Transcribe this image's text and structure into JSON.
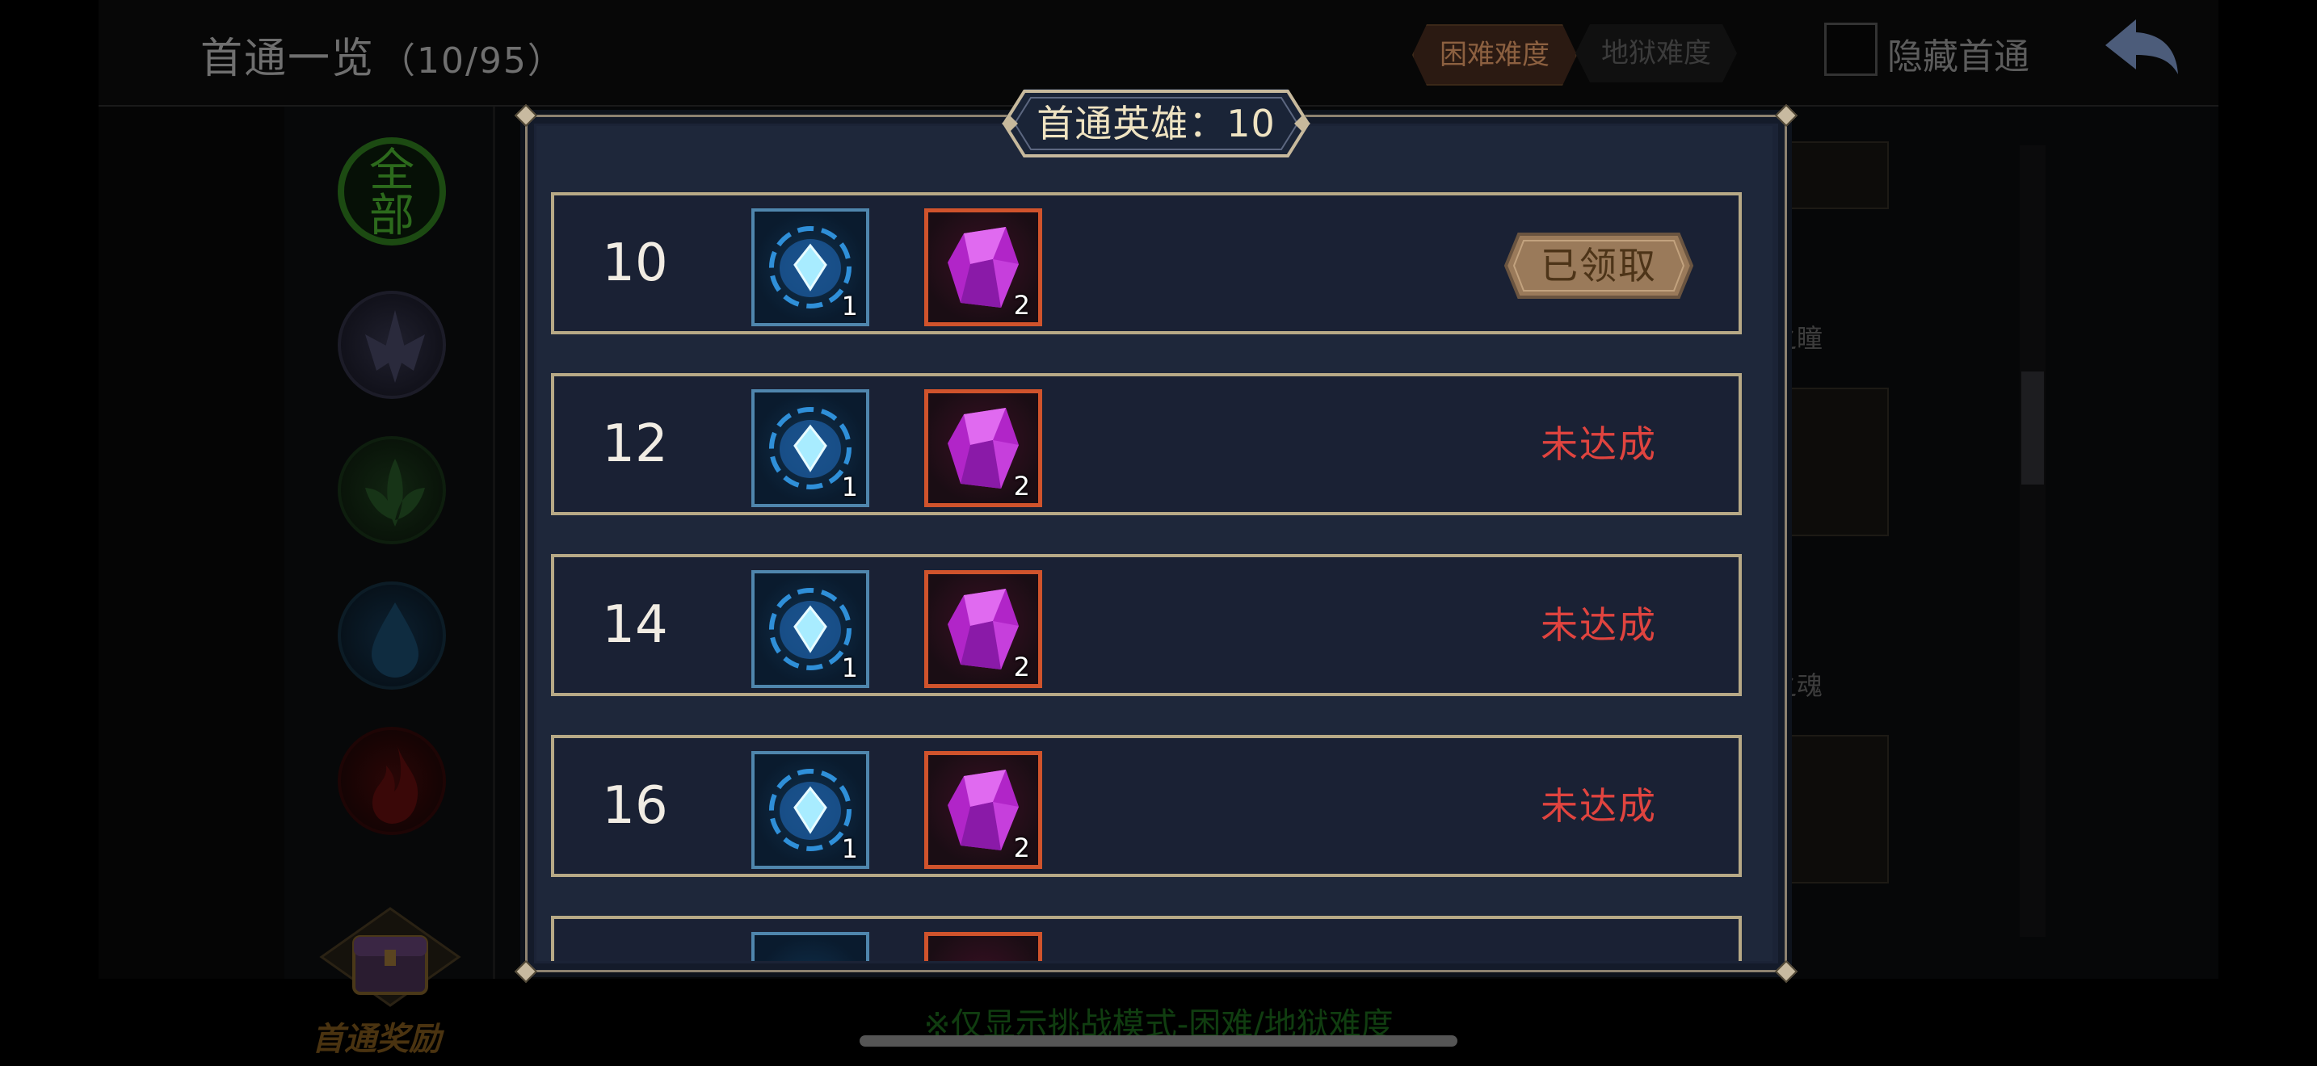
{
  "header": {
    "title": "首通一览",
    "count": "（10/95）",
    "tabs": [
      {
        "label": "困难难度",
        "active": true
      },
      {
        "label": "地狱难度",
        "active": false
      }
    ],
    "hide_checkbox_label": "隐藏首通",
    "hide_checked": false,
    "back_icon": "back-arrow-icon"
  },
  "sidebar": {
    "categories": [
      {
        "name": "all",
        "label": "全部"
      },
      {
        "name": "dark"
      },
      {
        "name": "nature"
      },
      {
        "name": "water"
      },
      {
        "name": "fire"
      }
    ],
    "reward_label": "首通奖励"
  },
  "background_cards": [
    "之瞳",
    "之魂"
  ],
  "bottom_note": "※仅显示挑战模式-困难/地狱难度",
  "modal": {
    "title": "首通英雄：10",
    "rows": [
      {
        "level": "10",
        "items": [
          {
            "icon": "blue-crystal-icon",
            "qty": "1"
          },
          {
            "icon": "purple-gem-icon",
            "qty": "2"
          }
        ],
        "status": "已领取",
        "state": "claimed"
      },
      {
        "level": "12",
        "items": [
          {
            "icon": "blue-crystal-icon",
            "qty": "1"
          },
          {
            "icon": "purple-gem-icon",
            "qty": "2"
          }
        ],
        "status": "未达成",
        "state": "pending"
      },
      {
        "level": "14",
        "items": [
          {
            "icon": "blue-crystal-icon",
            "qty": "1"
          },
          {
            "icon": "purple-gem-icon",
            "qty": "2"
          }
        ],
        "status": "未达成",
        "state": "pending"
      },
      {
        "level": "16",
        "items": [
          {
            "icon": "blue-crystal-icon",
            "qty": "1"
          },
          {
            "icon": "purple-gem-icon",
            "qty": "2"
          }
        ],
        "status": "未达成",
        "state": "pending"
      }
    ]
  },
  "colors": {
    "panel_bg": "#1e273a",
    "row_border": "#b7a986",
    "pending_text": "#e0443f",
    "claimed_plate": "#9a7a5a",
    "crystal_border": "#4f86ad",
    "gem_border": "#d0532c"
  }
}
